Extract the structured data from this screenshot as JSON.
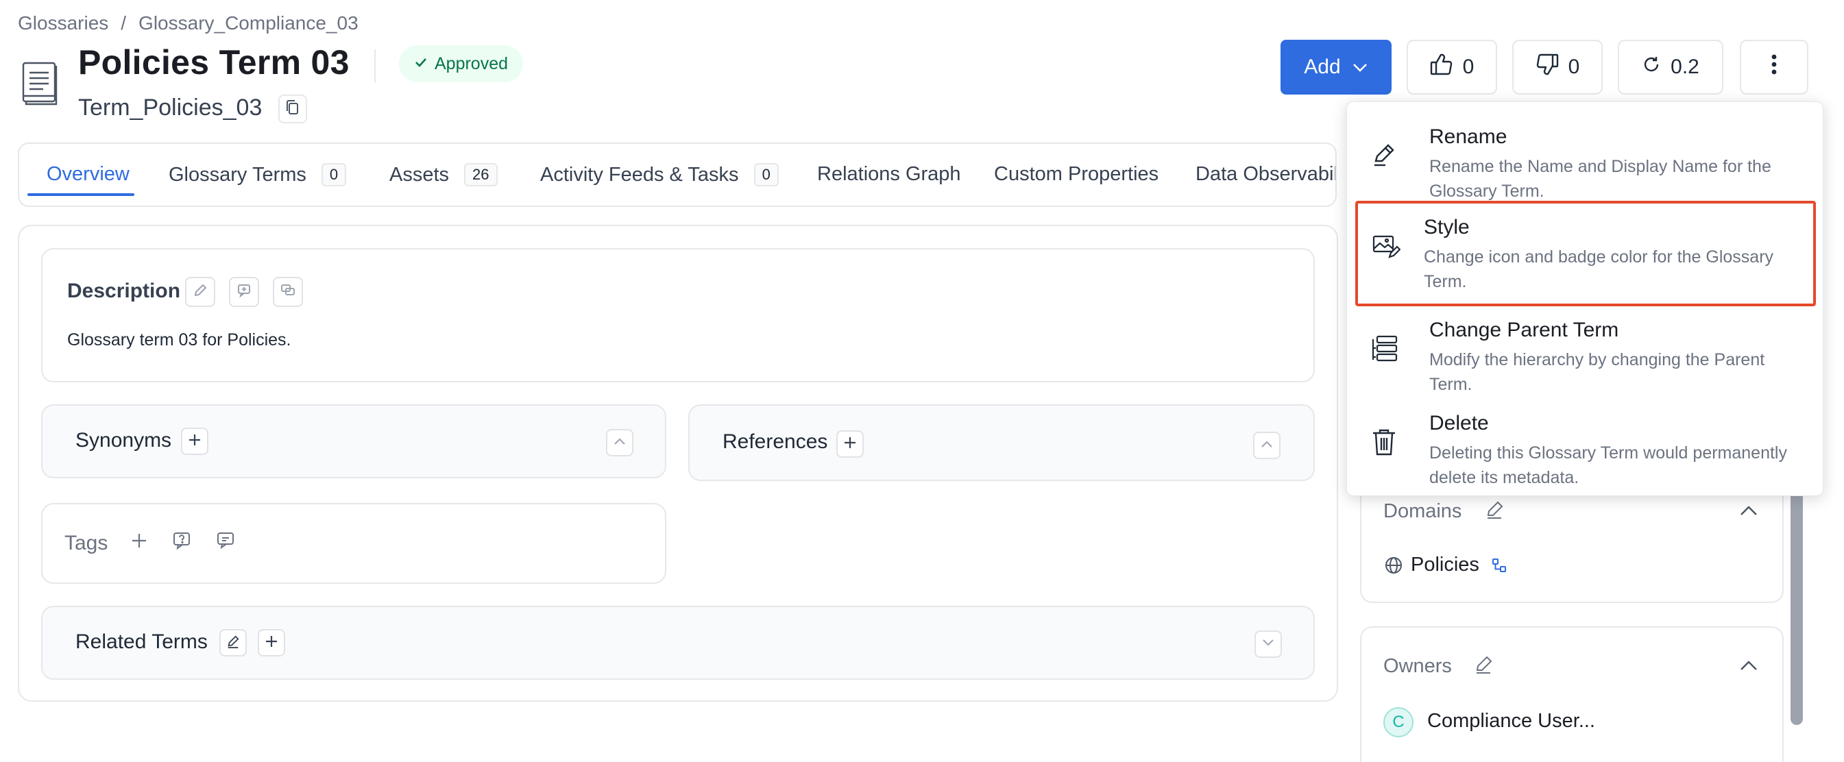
{
  "breadcrumb": {
    "root": "Glossaries",
    "separator": "/",
    "current": "Glossary_Compliance_03"
  },
  "header": {
    "title": "Policies Term 03",
    "status": "Approved",
    "fqn": "Term_Policies_03"
  },
  "actions": {
    "add_label": "Add",
    "upvotes": "0",
    "downvotes": "0",
    "version": "0.2"
  },
  "tabs": [
    {
      "label": "Overview"
    },
    {
      "label": "Glossary Terms",
      "count": "0"
    },
    {
      "label": "Assets",
      "count": "26"
    },
    {
      "label": "Activity Feeds & Tasks",
      "count": "0"
    },
    {
      "label": "Relations Graph"
    },
    {
      "label": "Custom Properties"
    },
    {
      "label": "Data Observabilit"
    }
  ],
  "description": {
    "title": "Description",
    "text": "Glossary term 03 for Policies."
  },
  "synonyms": {
    "title": "Synonyms"
  },
  "references": {
    "title": "References"
  },
  "tags": {
    "title": "Tags"
  },
  "related_terms": {
    "title": "Related Terms"
  },
  "domains": {
    "title": "Domains",
    "value": "Policies"
  },
  "owners": {
    "title": "Owners",
    "avatar_letter": "C",
    "value": "Compliance User..."
  },
  "menu": {
    "items": [
      {
        "label": "Rename",
        "description": "Rename the Name and Display Name for the Glossary Term."
      },
      {
        "label": "Style",
        "description": "Change icon and badge color for the Glossary Term."
      },
      {
        "label": "Change Parent Term",
        "description": "Modify the hierarchy by changing the Parent Term."
      },
      {
        "label": "Delete",
        "description": "Deleting this Glossary Term would permanently delete its metadata."
      }
    ]
  },
  "colors": {
    "primary": "#2e6cdf",
    "approved_bg": "#ecfdf3",
    "approved_text": "#067647",
    "highlight": "#e5492b"
  }
}
